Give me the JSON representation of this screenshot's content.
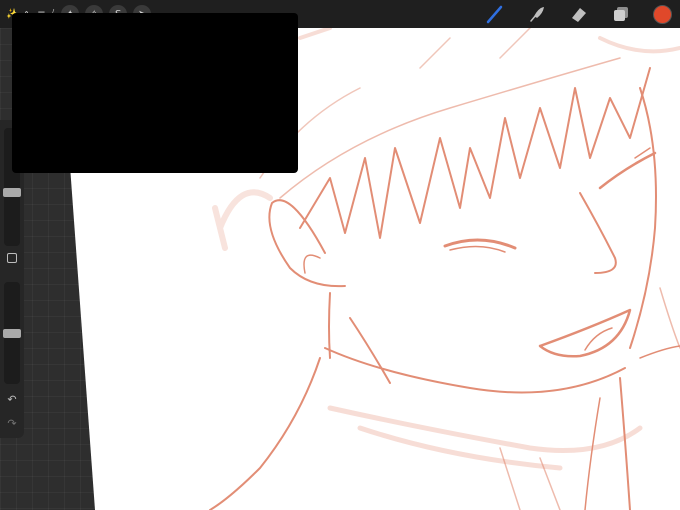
{
  "topbar": {
    "menu_text": "✨ ∿ ≡ ⧸",
    "buttons": [
      "✦",
      "✧",
      "S",
      "➤"
    ]
  },
  "tools": {
    "brush": "brush-icon",
    "smudge": "smudge-icon",
    "eraser": "eraser-icon",
    "layers": "layers-icon",
    "color_hex": "#e0482a"
  },
  "sidebar": {
    "size_slider_value": 0.45,
    "opacity_slider_value": 0.5,
    "undo_label": "↶",
    "redo_label": "↷"
  },
  "colors": {
    "sketch_stroke": "#dd7a5e",
    "canvas_bg": "#ffffff",
    "brush_blue": "#2f6fe0"
  }
}
